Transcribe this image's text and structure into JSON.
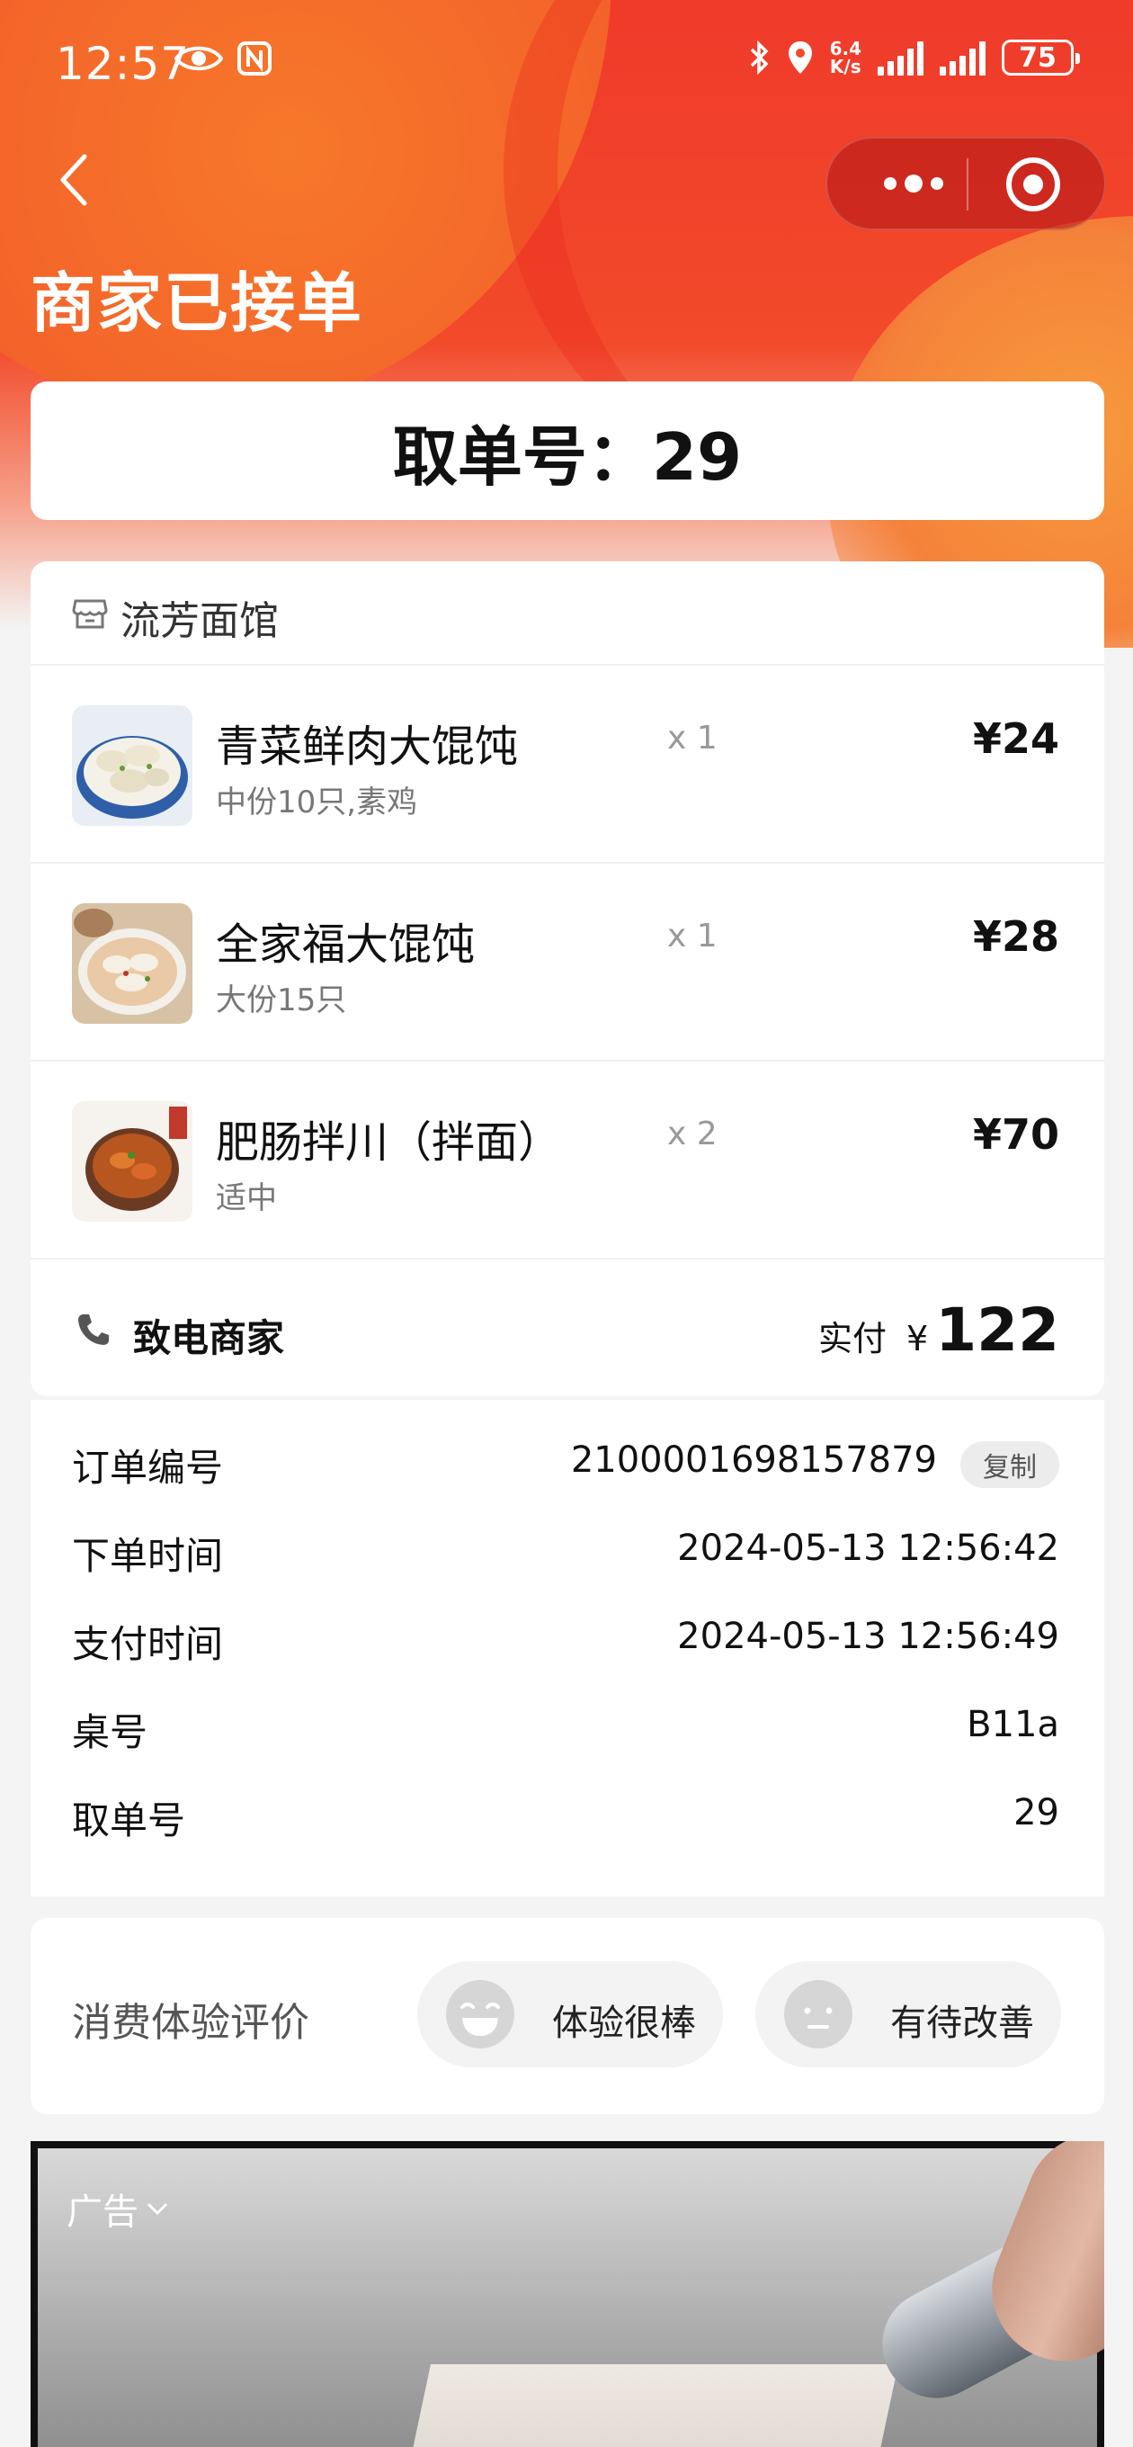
{
  "status_bar": {
    "time": "12:57",
    "net_speed_top": "6.4",
    "net_speed_bottom": "K/s",
    "battery": "75"
  },
  "nav": {
    "title": "商家已接单"
  },
  "pickup": {
    "text": "取单号：29"
  },
  "order": {
    "shop_name": "流芳面馆",
    "items": [
      {
        "name": "青菜鲜肉大馄饨",
        "spec": "中份10只,素鸡",
        "qty": "x 1",
        "price": "¥24"
      },
      {
        "name": "全家福大馄饨",
        "spec": "大份15只",
        "qty": "x 1",
        "price": "¥28"
      },
      {
        "name": "肥肠拌川（拌面）",
        "spec": "适中",
        "qty": "x 2",
        "price": "¥70"
      }
    ],
    "call_label": "致电商家",
    "paid_label": "实付",
    "currency": "¥",
    "paid_amount": "122"
  },
  "details": {
    "order_no_label": "订单编号",
    "order_no": "2100001698157879",
    "copy_label": "复制",
    "order_time_label": "下单时间",
    "order_time": "2024-05-13 12:56:42",
    "pay_time_label": "支付时间",
    "pay_time": "2024-05-13 12:56:49",
    "table_label": "桌号",
    "table": "B11a",
    "pickup_label": "取单号",
    "pickup_no": "29"
  },
  "rating": {
    "title": "消费体验评价",
    "good": "体验很棒",
    "improve": "有待改善"
  },
  "ad": {
    "label": "广告"
  },
  "colors": {
    "brand_red": "#f03a2a",
    "brand_orange": "#f7782a"
  }
}
